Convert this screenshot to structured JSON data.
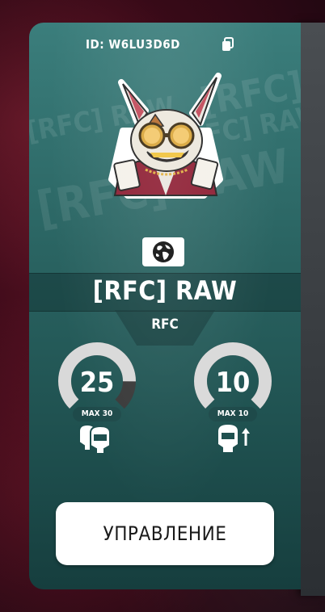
{
  "card": {
    "id_text": "ID: W6LU3D6D",
    "watermark_text": "[RFC] RAW",
    "clan_name": "[RFC] RAW",
    "clan_tag": "RFC",
    "region_icon": "globe-icon",
    "copy_icon": "copy-icon",
    "avatar_icon": "rabbit-emblem-icon",
    "accent_color": "#2a6462"
  },
  "members": {
    "value": "25",
    "max_label": "MAX 30",
    "fill_fraction": 0.8333,
    "icon": "members-icon"
  },
  "capacity": {
    "value": "10",
    "max_label": "MAX 10",
    "fill_fraction": 1.0,
    "icon": "capacity-upgrade-icon"
  },
  "manage_button": {
    "label": "УПРАВЛЕНИЕ"
  }
}
